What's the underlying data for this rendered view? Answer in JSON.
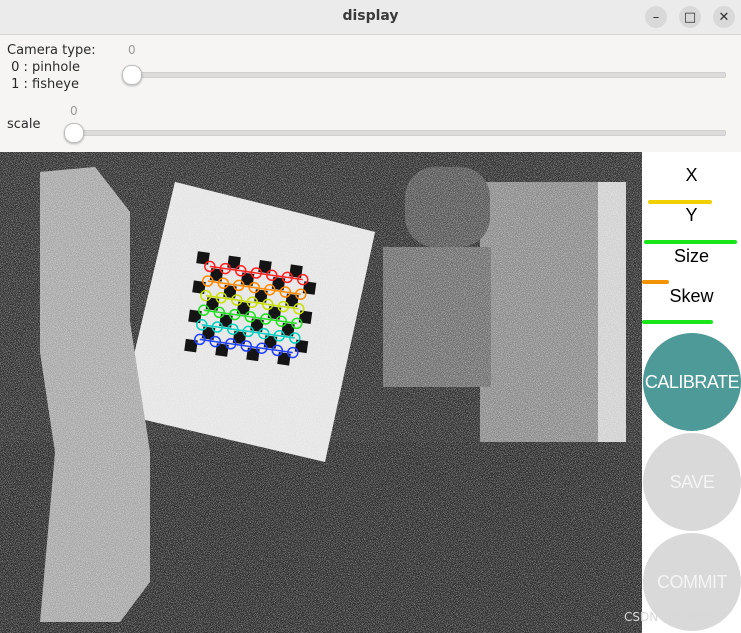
{
  "window": {
    "title": "display",
    "minimize_glyph": "–",
    "maximize_glyph": "□",
    "close_glyph": "✕"
  },
  "controls": {
    "camera_type": {
      "label": "Camera type:\n 0 : pinhole\n 1 : fisheye",
      "value": "0",
      "slider_fraction": 0
    },
    "scale": {
      "label": "scale",
      "value": "0",
      "slider_fraction": 0
    }
  },
  "panel": {
    "metrics": [
      {
        "label": "X",
        "bar_color": "#f2d000",
        "level": 0.65
      },
      {
        "label": "Y",
        "bar_color": "#19e619",
        "level": 0.95
      },
      {
        "label": "Size",
        "bar_color": "#f29400",
        "level": 0.28
      },
      {
        "label": "Skew",
        "bar_color": "#19e619",
        "level": 0.72
      }
    ],
    "buttons": {
      "calibrate": "CALIBRATE",
      "save": "SAVE",
      "commit": "COMMIT"
    },
    "colors": {
      "calibrate_bg": "#4d9a98",
      "disabled_bg": "#d9d9d9"
    }
  },
  "watermark": "CSDN @韭菜钟",
  "chessboard_row_colors": [
    "#ff2020",
    "#ff8a00",
    "#c8e000",
    "#20e020",
    "#00d0c0",
    "#2040ff",
    "#c020ff"
  ]
}
